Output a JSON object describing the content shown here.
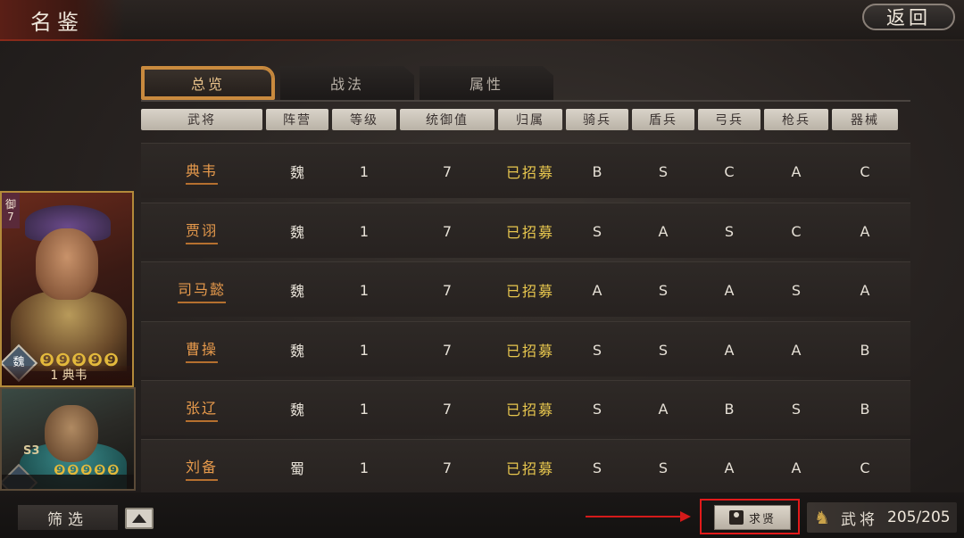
{
  "header": {
    "title": "名鉴",
    "back_label": "返回"
  },
  "tabs": [
    {
      "label": "总览",
      "active": true
    },
    {
      "label": "战法",
      "active": false
    },
    {
      "label": "属性",
      "active": false
    }
  ],
  "columns": [
    "武将",
    "阵营",
    "等级",
    "统御值",
    "归属",
    "骑兵",
    "盾兵",
    "弓兵",
    "枪兵",
    "器械"
  ],
  "rows": [
    {
      "name": "典韦",
      "faction": "魏",
      "level": "1",
      "command": "7",
      "status": "已招募",
      "cavalry": "B",
      "shield": "S",
      "archer": "C",
      "spear": "A",
      "siege": "C"
    },
    {
      "name": "贾诩",
      "faction": "魏",
      "level": "1",
      "command": "7",
      "status": "已招募",
      "cavalry": "S",
      "shield": "A",
      "archer": "S",
      "spear": "C",
      "siege": "A"
    },
    {
      "name": "司马懿",
      "faction": "魏",
      "level": "1",
      "command": "7",
      "status": "已招募",
      "cavalry": "A",
      "shield": "S",
      "archer": "A",
      "spear": "S",
      "siege": "A"
    },
    {
      "name": "曹操",
      "faction": "魏",
      "level": "1",
      "command": "7",
      "status": "已招募",
      "cavalry": "S",
      "shield": "S",
      "archer": "A",
      "spear": "A",
      "siege": "B"
    },
    {
      "name": "张辽",
      "faction": "魏",
      "level": "1",
      "command": "7",
      "status": "已招募",
      "cavalry": "S",
      "shield": "A",
      "archer": "B",
      "spear": "S",
      "siege": "B"
    },
    {
      "name": "刘备",
      "faction": "蜀",
      "level": "1",
      "command": "7",
      "status": "已招募",
      "cavalry": "S",
      "shield": "S",
      "archer": "A",
      "spear": "A",
      "siege": "C"
    }
  ],
  "cards": [
    {
      "tag_top": "御",
      "tag_bottom": "7",
      "faction": "魏",
      "stars": "5",
      "name": "1 典韦",
      "icon": "dian-wei-portrait"
    },
    {
      "cost": "S3",
      "faction": "",
      "stars": "5",
      "name": "",
      "icon": "general-portrait"
    }
  ],
  "footer": {
    "filter_label": "筛选",
    "recruit_label": "求贤",
    "generals_label": "武将",
    "generals_count": "205/205"
  },
  "colors": {
    "accent_orange": "#e79a4c",
    "status_yellow": "#e7c64e",
    "tab_border": "#c98a3e",
    "highlight_red": "#e21a1a"
  }
}
